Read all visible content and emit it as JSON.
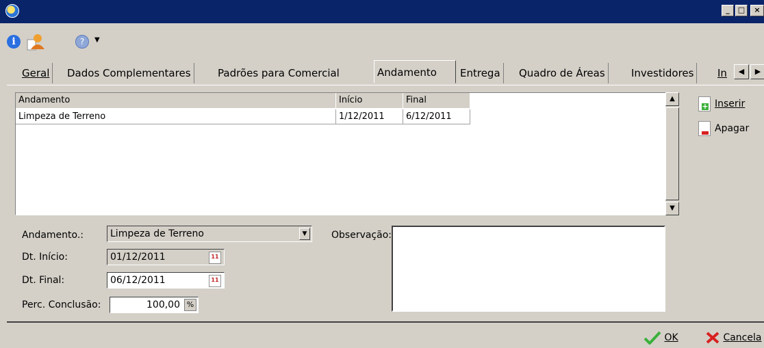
{
  "window": {
    "minimize_glyph": "_",
    "maximize_glyph": "□",
    "close_glyph": "×"
  },
  "toolbar": {
    "info_icon_glyph": "i",
    "help_icon_glyph": "?",
    "dropdown_glyph": "▼"
  },
  "tabs": [
    {
      "label": "Geral"
    },
    {
      "label": "Dados Complementares"
    },
    {
      "label": "Padrões para Comercial"
    },
    {
      "label": "Andamento"
    },
    {
      "label": "Entrega"
    },
    {
      "label": "Quadro de Áreas"
    },
    {
      "label": "Investidores"
    },
    {
      "label": "In"
    }
  ],
  "tab_scroll": {
    "left": "◀",
    "right": "▶"
  },
  "grid": {
    "columns": [
      "Andamento",
      "Início",
      "Final"
    ],
    "rows": [
      {
        "andamento": "Limpeza de Terreno",
        "inicio": "1/12/2011",
        "final": "6/12/2011"
      }
    ],
    "scroll_up": "▲",
    "scroll_down": "▼"
  },
  "actions": {
    "insert_label": "Inserir",
    "delete_label": "Apagar"
  },
  "form": {
    "andamento_label": "Andamento.:",
    "andamento_value": "Limpeza de Terreno",
    "inicio_label": "Dt. Início:",
    "inicio_value": "01/12/2011",
    "final_label": "Dt. Final:",
    "final_value": "06/12/2011",
    "perc_label": "Perc. Conclusão:",
    "perc_value": "100,00",
    "perc_symbol": "%",
    "obs_label": "Observação:",
    "calendar_glyph": "11",
    "combo_arrow": "▼"
  },
  "footer": {
    "ok_label": "OK",
    "cancel_label": "Cancela"
  },
  "colors": {
    "titlebar": "#0a246a",
    "face": "#d4d0c8",
    "ok_check": "#3ab03a",
    "cancel_x": "#d82020"
  }
}
